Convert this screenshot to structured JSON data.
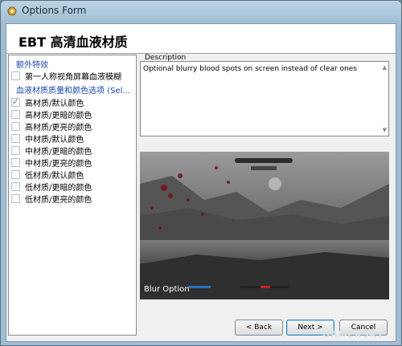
{
  "window": {
    "title": "Options Form",
    "app_icon": "gear-icon"
  },
  "header": {
    "title": "EBT 高清血液材质"
  },
  "options": {
    "groups": [
      {
        "label": "额外特效",
        "items": [
          {
            "label": "第一人称视角屏幕血液模糊",
            "checked": false
          }
        ]
      },
      {
        "label": "血液材质质量和颜色选项 (Sel...",
        "items": [
          {
            "label": "高材质/默认颜色",
            "checked": true
          },
          {
            "label": "高材质/更暗的颜色",
            "checked": false
          },
          {
            "label": "高材质/更亮的颜色",
            "checked": false
          },
          {
            "label": "中材质/默认颜色",
            "checked": false
          },
          {
            "label": "中材质/更暗的颜色",
            "checked": false
          },
          {
            "label": "中材质/更亮的颜色",
            "checked": false
          },
          {
            "label": "低材质/默认颜色",
            "checked": false
          },
          {
            "label": "低材质/更暗的颜色",
            "checked": false
          },
          {
            "label": "低材质/更亮的颜色",
            "checked": false
          }
        ]
      }
    ]
  },
  "description": {
    "label": "Description",
    "text": "Optional blurry blood spots on screen instead of clear ones"
  },
  "preview": {
    "caption": "Blur Option"
  },
  "buttons": {
    "back": "< Back",
    "next": "Next >",
    "cancel": "Cancel"
  },
  "watermark": "GAMERSKY"
}
